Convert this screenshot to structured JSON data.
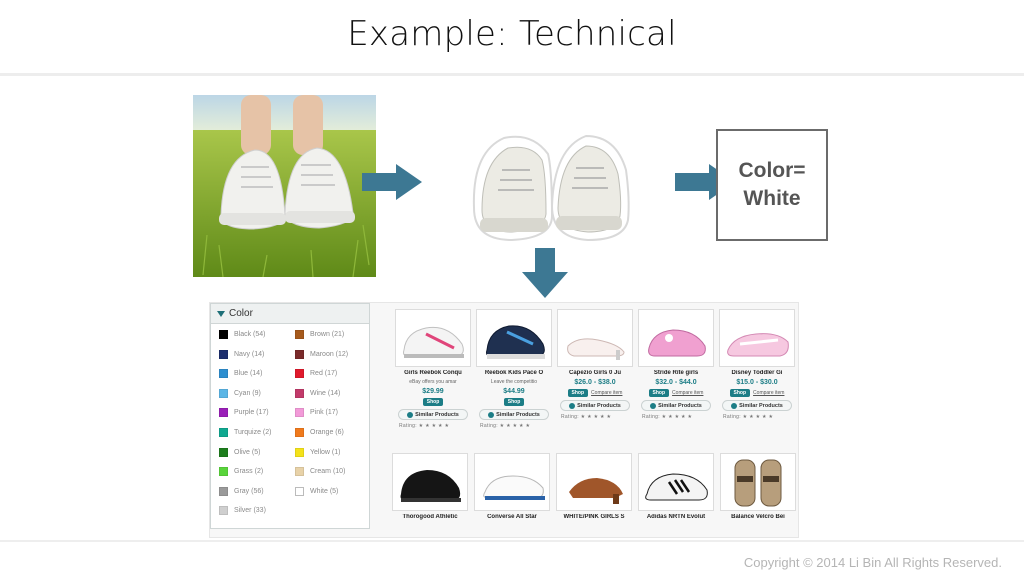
{
  "slide": {
    "title": "Example: Technical",
    "copyright": "Copyright © 2014 Li Bin All Rights Reserved."
  },
  "result_box": {
    "line1": "Color=",
    "line2": "White"
  },
  "colors": {
    "arrow": "#3d7893",
    "teal": "#1c7d86"
  },
  "facet": {
    "title": "Color",
    "left": [
      {
        "label": "Black (54)",
        "color": "#000000"
      },
      {
        "label": "Navy (14)",
        "color": "#1d2f6e"
      },
      {
        "label": "Blue (14)",
        "color": "#2e8fd0"
      },
      {
        "label": "Cyan (9)",
        "color": "#5cb6e6"
      },
      {
        "label": "Purple (17)",
        "color": "#9a1fb8"
      },
      {
        "label": "Turquize (2)",
        "color": "#10a890"
      },
      {
        "label": "Olive (5)",
        "color": "#1d7d1d"
      },
      {
        "label": "Grass (2)",
        "color": "#59d43b"
      },
      {
        "label": "Gray (56)",
        "color": "#9a9a9a"
      },
      {
        "label": "Silver (33)",
        "color": "#cfcfcf"
      }
    ],
    "right": [
      {
        "label": "Brown (21)",
        "color": "#a65a1c"
      },
      {
        "label": "Maroon (12)",
        "color": "#7a2a2a"
      },
      {
        "label": "Red (17)",
        "color": "#e01a2c"
      },
      {
        "label": "Wine (14)",
        "color": "#c23a6a"
      },
      {
        "label": "Pink (17)",
        "color": "#f29ad8"
      },
      {
        "label": "Orange (6)",
        "color": "#f07a1c"
      },
      {
        "label": "Yellow (1)",
        "color": "#f4e21a"
      },
      {
        "label": "Cream (10)",
        "color": "#e8d2a8"
      },
      {
        "label": "White (5)",
        "color": "#ffffff"
      }
    ]
  },
  "products_row1": [
    {
      "name": "Girls Reebok Conqu",
      "desc": "eBay offers you amar",
      "price": "$29.99",
      "shop": "Shop",
      "compare": "",
      "similar": "Similar Products",
      "rating": "Rating: ★ ★ ★ ★ ★"
    },
    {
      "name": "Reebok Kids Pace O",
      "desc": "Leave the competitio",
      "price": "$44.99",
      "shop": "Shop",
      "compare": "",
      "similar": "Similar Products",
      "rating": "Rating: ★ ★ ★ ★ ★"
    },
    {
      "name": "Capezio Girls 0 Ju",
      "desc": "",
      "price": "$26.0 - $38.0",
      "shop": "Shop",
      "compare": "Compare item",
      "similar": "Similar Products",
      "rating": "Rating: ★ ★ ★ ★ ★"
    },
    {
      "name": "Stride Rite girls",
      "desc": "",
      "price": "$32.0 - $44.0",
      "shop": "Shop",
      "compare": "Compare item",
      "similar": "Similar Products",
      "rating": "Rating: ★ ★ ★ ★ ★"
    },
    {
      "name": "Disney Toddler Gi",
      "desc": "",
      "price": "$15.0 - $30.0",
      "shop": "Shop",
      "compare": "Compare item",
      "similar": "Similar Products",
      "rating": "Rating: ★ ★ ★ ★ ★"
    }
  ],
  "products_row2": [
    {
      "name": "Thorogood Athletic"
    },
    {
      "name": "Converse All Star"
    },
    {
      "name": "WHITE/PINK GIRLS S"
    },
    {
      "name": "Adidas NRTN Evolut"
    },
    {
      "name": "Balance Velcro Bei"
    }
  ]
}
